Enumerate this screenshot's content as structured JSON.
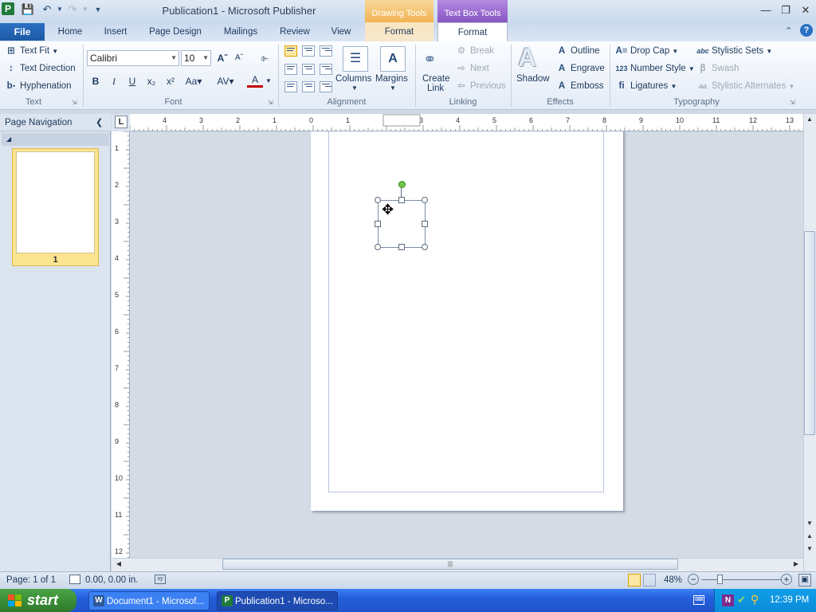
{
  "window": {
    "title": "Publication1 - Microsoft Publisher",
    "app_icon": "publisher-icon",
    "context_tabs": {
      "drawing_tools": "Drawing Tools",
      "text_box_tools": "Text Box Tools"
    }
  },
  "tabs": [
    "File",
    "Home",
    "Insert",
    "Page Design",
    "Mailings",
    "Review",
    "View",
    "Format",
    "Format"
  ],
  "ribbon": {
    "text_group": {
      "label": "Text",
      "text_fit": "Text Fit",
      "text_direction": "Text Direction",
      "hyphenation": "Hyphenation"
    },
    "font_group": {
      "label": "Font",
      "font_name": "Calibri",
      "font_size": "10"
    },
    "alignment_group": {
      "label": "Alignment",
      "columns": "Columns",
      "margins": "Margins"
    },
    "linking_group": {
      "label": "Linking",
      "create_link_1": "Create",
      "create_link_2": "Link",
      "break": "Break",
      "next": "Next",
      "previous": "Previous"
    },
    "effects_group": {
      "label": "Effects",
      "shadow": "Shadow",
      "outline": "Outline",
      "engrave": "Engrave",
      "emboss": "Emboss"
    },
    "typography_group": {
      "label": "Typography",
      "drop_cap": "Drop Cap",
      "number_style": "Number Style",
      "ligatures": "Ligatures",
      "stylistic_sets": "Stylistic Sets",
      "swash": "Swash",
      "stylistic_alternates": "Stylistic Alternates"
    }
  },
  "nav": {
    "title": "Page Navigation",
    "page_number": "1"
  },
  "ruler": {
    "h_labels": [
      "4",
      "3",
      "2",
      "1",
      "0",
      "1",
      "2",
      "3",
      "4",
      "5",
      "6",
      "7",
      "8",
      "9",
      "10",
      "11",
      "12",
      "13"
    ],
    "v_labels": [
      "1",
      "2",
      "3",
      "4",
      "5",
      "6",
      "7",
      "8",
      "9",
      "10",
      "11",
      "12"
    ]
  },
  "status": {
    "page": "Page: 1 of 1",
    "position": "0.00, 0.00 in.",
    "zoom": "48%"
  },
  "taskbar": {
    "start": "start",
    "word_task": "Document1 - Microsof...",
    "publisher_task": "Publication1 - Microso...",
    "clock": "12:39 PM"
  },
  "colors": {
    "file_tab": "#2b70c4",
    "textbox_tools": "#8451c1",
    "drawing_tools": "#f1b14c",
    "taskbar": "#245edb",
    "start": "#3b8e37"
  }
}
